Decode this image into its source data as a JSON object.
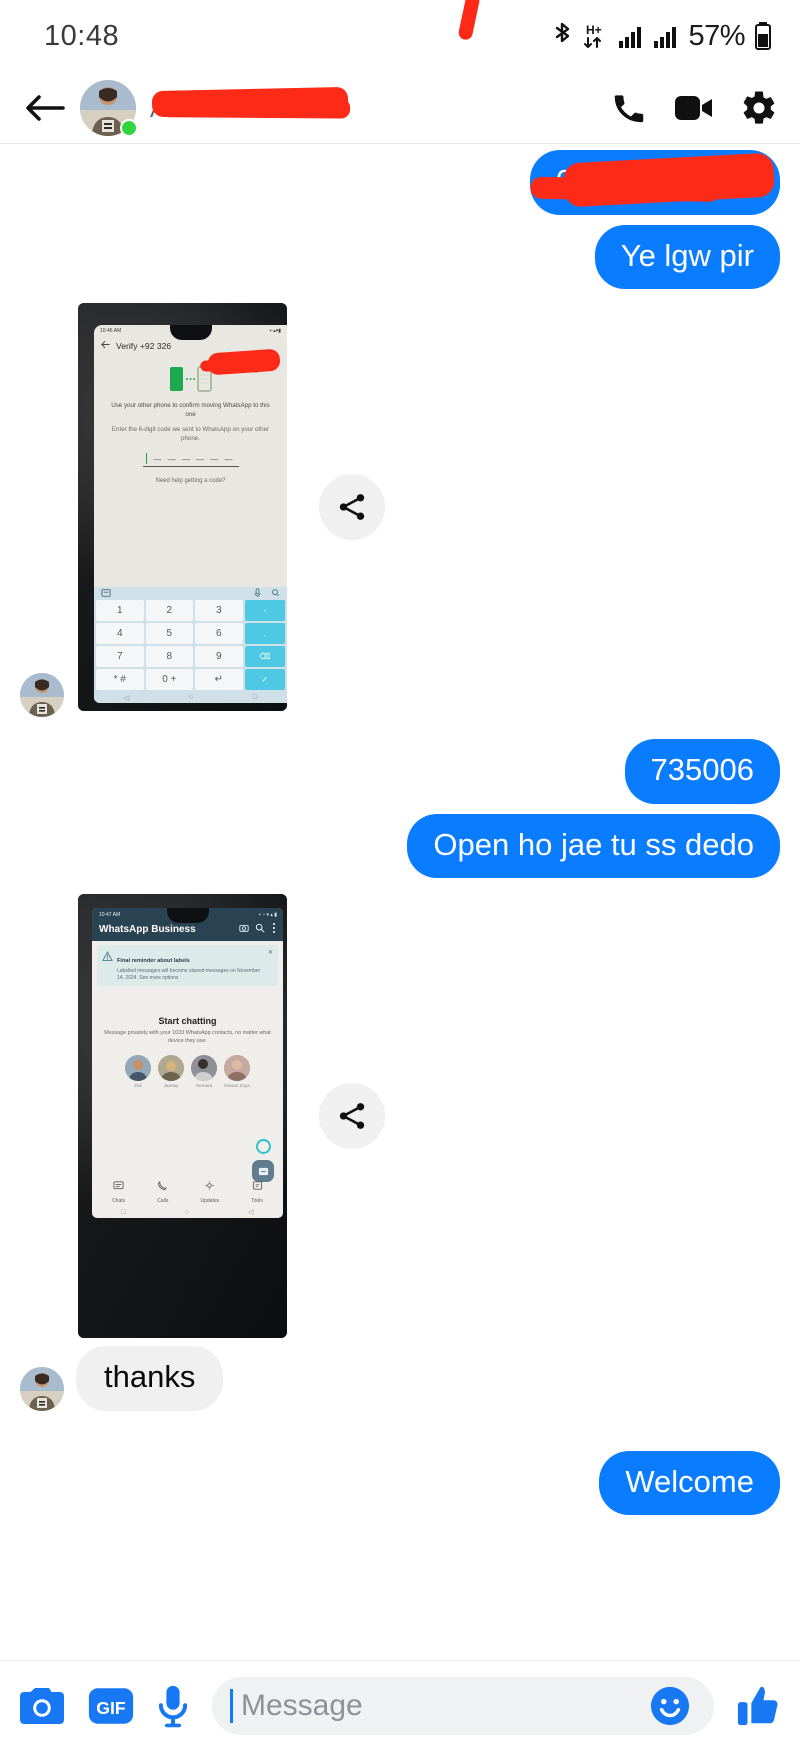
{
  "status_bar": {
    "time": "10:48",
    "battery_percent": "57%",
    "icons": [
      "bluetooth-icon",
      "hplus-data-icon",
      "signal-bars-icon-1",
      "signal-bars-icon-2",
      "battery-icon"
    ]
  },
  "chat_header": {
    "contact_name": "",
    "name_is_redacted": true,
    "presence": "Active now",
    "actions": [
      "audio-call-icon",
      "video-call-icon",
      "settings-gear-icon"
    ]
  },
  "messages": [
    {
      "id": "m1",
      "direction": "out",
      "type": "text",
      "text": "0326",
      "redacted": true
    },
    {
      "id": "m2",
      "direction": "out",
      "type": "text",
      "text": "Ye lgw pir"
    },
    {
      "id": "m3",
      "direction": "in",
      "type": "photo",
      "share_icon": "share-icon",
      "photo": {
        "kind": "whatsapp-verify-screen-photo",
        "status_time": "10:46 AM",
        "toolbar_title": "Verify +92 326",
        "toolbar_redacted": true,
        "line1": "Use your other phone to confirm moving WhatsApp to this one",
        "line2": "Enter the 6-digit code we sent to WhatsApp on your other phone.",
        "code_placeholder": "— — —   — — —",
        "help_link": "Need help getting a code?",
        "keypad": [
          "1",
          "2",
          "3",
          "4",
          "5",
          "6",
          "7",
          "8",
          "9",
          "* #",
          "0 +"
        ]
      }
    },
    {
      "id": "m4",
      "direction": "out",
      "type": "text",
      "text": "735006"
    },
    {
      "id": "m5",
      "direction": "out",
      "type": "text",
      "text": "Open ho jae tu ss dedo"
    },
    {
      "id": "m6",
      "direction": "in",
      "type": "photo",
      "share_icon": "share-icon",
      "photo": {
        "kind": "whatsapp-business-home-photo",
        "status_time": "10:47 AM",
        "app_title": "WhatsApp Business",
        "banner_title": "Final reminder about labels",
        "banner_body": "Labelled messages will become starred messages on November 14, 2024. See more options",
        "start_title": "Start chatting",
        "start_body": "Message privately with your 1033 WhatsApp contacts, no matter what device they use.",
        "contacts": [
          {
            "name": "Zaii"
          },
          {
            "name": "Jaanay"
          },
          {
            "name": "Hamara"
          },
          {
            "name": "Nawaz Zoya"
          }
        ],
        "nav": [
          {
            "label": "Chats",
            "icon": "chats-icon"
          },
          {
            "label": "Calls",
            "icon": "calls-icon"
          },
          {
            "label": "Updates",
            "icon": "updates-icon"
          },
          {
            "label": "Tools",
            "icon": "tools-icon"
          }
        ]
      }
    },
    {
      "id": "m7",
      "direction": "in",
      "type": "text",
      "text": "thanks"
    },
    {
      "id": "m8",
      "direction": "out",
      "type": "text",
      "text": "Welcome"
    }
  ],
  "composer": {
    "camera_label": "camera-icon",
    "gif_label": "GIF",
    "mic_label": "microphone-icon",
    "input_value": "",
    "input_placeholder": "Message",
    "emoji_label": "emoji-smiley-icon",
    "like_label": "thumbs-up-icon"
  },
  "colors": {
    "outgoing_bubble": "#0a7cff",
    "incoming_bubble": "#f0f0f0",
    "redaction": "#fc2a16",
    "online_dot": "#31d53f",
    "accent": "#0a7cff"
  }
}
